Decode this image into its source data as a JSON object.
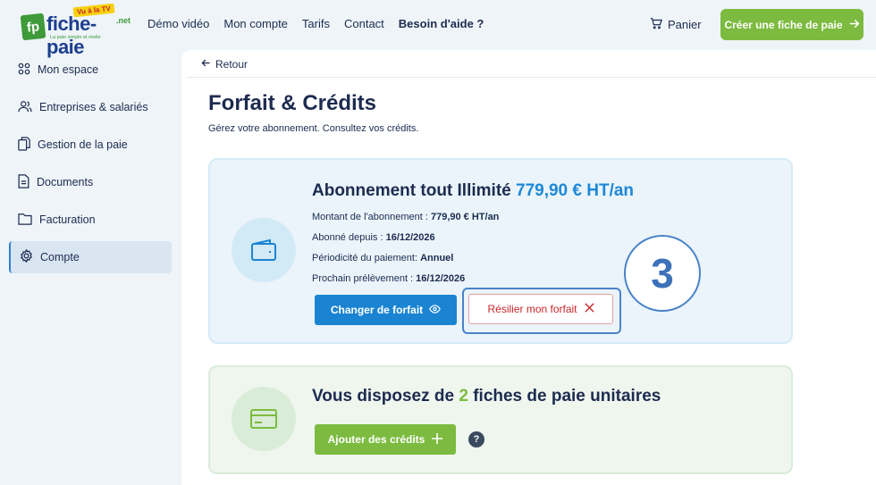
{
  "header": {
    "logo": {
      "mark": "fp",
      "name": "fiche-paie",
      "suffix": ".net",
      "badge": "Vu à la TV",
      "tagline": "La paie simple et réelle"
    },
    "nav": [
      {
        "label": "Démo vidéo"
      },
      {
        "label": "Mon compte"
      },
      {
        "label": "Tarifs"
      },
      {
        "label": "Contact"
      },
      {
        "label": "Besoin d'aide ?"
      }
    ],
    "cart_label": "Panier",
    "cta_label": "Créer une fiche de paie"
  },
  "sidebar": {
    "items": [
      {
        "label": "Mon espace",
        "icon": "grid-icon"
      },
      {
        "label": "Entreprises & salariés",
        "icon": "users-icon"
      },
      {
        "label": "Gestion de la paie",
        "icon": "files-icon"
      },
      {
        "label": "Documents",
        "icon": "document-icon"
      },
      {
        "label": "Facturation",
        "icon": "folder-icon"
      },
      {
        "label": "Compte",
        "icon": "gear-icon",
        "active": true
      }
    ]
  },
  "main": {
    "back_label": "Retour",
    "title": "Forfait & Crédits",
    "subtitle": "Gérez votre abonnement. Consultez vos crédits.",
    "subscription": {
      "title": "Abonnement tout Illimité",
      "price": "779,90 € HT/an",
      "lines": [
        {
          "label": "Montant de l'abonnement : ",
          "value": "779,90 € HT/an"
        },
        {
          "label": "Abonné depuis : ",
          "value": "16/12/2026"
        },
        {
          "label": "Périodicité du paiement: ",
          "value": "Annuel"
        },
        {
          "label": "Prochain prélèvement : ",
          "value": "16/12/2026"
        }
      ],
      "change_button": "Changer de forfait",
      "cancel_button": "Résilier mon forfait",
      "step_number": "3"
    },
    "credits": {
      "title_prefix": "Vous disposez de ",
      "count": "2",
      "title_suffix": " fiches de paie unitaires",
      "add_button": "Ajouter des crédits",
      "help": "?"
    }
  },
  "colors": {
    "brand_green": "#7cbb3f",
    "brand_blue": "#1a84d2",
    "danger": "#c8262a",
    "text": "#1d2b4f"
  }
}
